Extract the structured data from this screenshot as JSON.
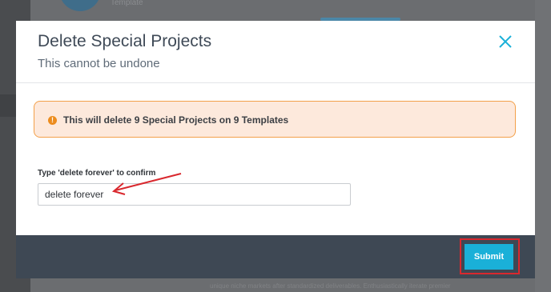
{
  "background": {
    "subtitle": "Template",
    "bottom_text": "unique niche markets after standardized deliverables. Enthusiastically iterate premier"
  },
  "modal": {
    "title": "Delete Special Projects",
    "subtitle": "This cannot be undone",
    "close_icon": "close-x-icon",
    "warning": {
      "icon": "exclamation-circle-icon",
      "icon_glyph": "!",
      "text": "This will delete 9 Special Projects on 9 Templates"
    },
    "confirm": {
      "label": "Type 'delete forever' to confirm",
      "value": "delete forever"
    },
    "footer": {
      "submit_label": "Submit"
    }
  },
  "colors": {
    "accent": "#1ab0d8",
    "warning_border": "#f3a04a",
    "warning_bg": "#fde9dc",
    "footer_bg": "#3e4854",
    "annotation_red": "#d9282e"
  }
}
